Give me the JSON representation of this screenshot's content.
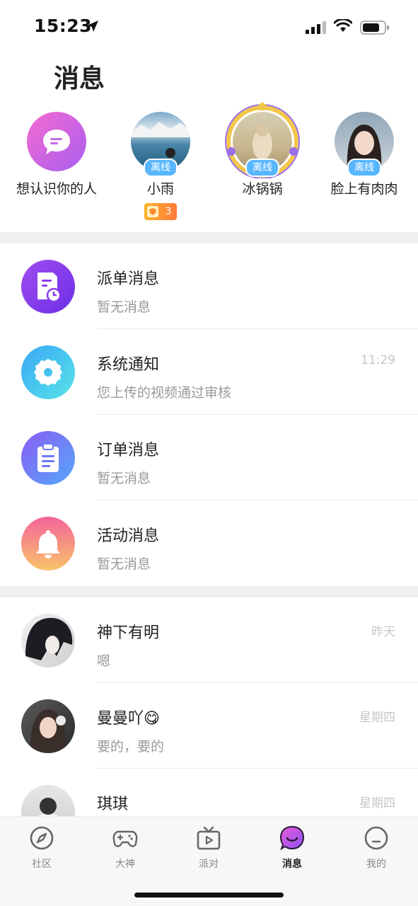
{
  "status_bar": {
    "time": "15:23"
  },
  "header": {
    "title": "消息"
  },
  "stories": [
    {
      "name": "想认识你的人",
      "icon": "chat-bubble-icon"
    },
    {
      "name": "小雨",
      "status": "离线",
      "level": "3"
    },
    {
      "name": "冰锅锅",
      "status": "离线"
    },
    {
      "name": "脸上有肉肉",
      "status": "离线"
    }
  ],
  "system_messages": [
    {
      "title": "派单消息",
      "subtitle": "暂无消息",
      "time": "",
      "icon": "dispatch-doc-icon"
    },
    {
      "title": "系统通知",
      "subtitle": "您上传的视频通过审核",
      "time": "11:29",
      "icon": "gear-icon"
    },
    {
      "title": "订单消息",
      "subtitle": "暂无消息",
      "time": "",
      "icon": "clipboard-icon"
    },
    {
      "title": "活动消息",
      "subtitle": "暂无消息",
      "time": "",
      "icon": "bell-icon"
    }
  ],
  "chats": [
    {
      "name": "神下有明",
      "preview": "嗯",
      "time": "昨天"
    },
    {
      "name": "曼曼吖😋",
      "preview": "要的，要的",
      "time": "星期四"
    },
    {
      "name": "琪琪",
      "preview": "",
      "time": "星期四"
    }
  ],
  "tab_bar": {
    "tabs": [
      {
        "label": "社区",
        "icon": "compass-icon",
        "active": false
      },
      {
        "label": "大神",
        "icon": "gamepad-icon",
        "active": false
      },
      {
        "label": "派对",
        "icon": "tv-play-icon",
        "active": false
      },
      {
        "label": "消息",
        "icon": "message-bubble-icon",
        "active": true
      },
      {
        "label": "我的",
        "icon": "face-icon",
        "active": false
      }
    ]
  },
  "colors": {
    "offline_badge": "#58b6ff",
    "dispatch": "#8b3cf0",
    "system": "#3fc8f0",
    "order": "#6a79f5",
    "activity": "#f7896f"
  }
}
